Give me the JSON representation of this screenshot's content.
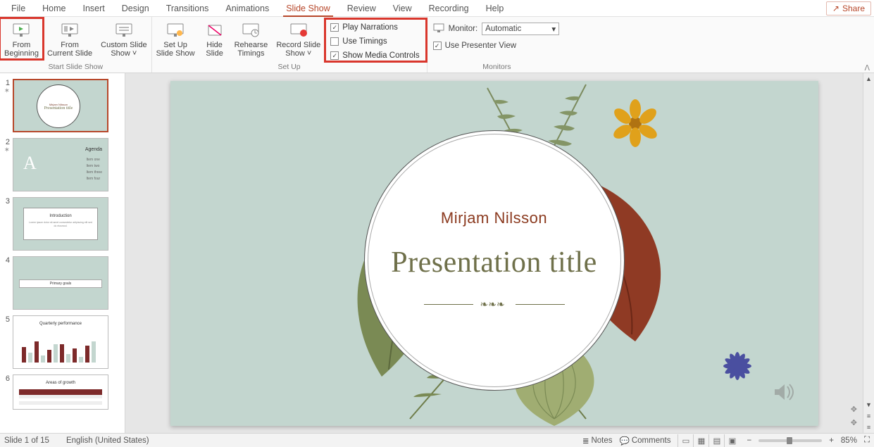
{
  "tabs": [
    "File",
    "Home",
    "Insert",
    "Design",
    "Transitions",
    "Animations",
    "Slide Show",
    "Review",
    "View",
    "Recording",
    "Help"
  ],
  "active_tab": "Slide Show",
  "share_label": "Share",
  "ribbon": {
    "start_group_label": "Start Slide Show",
    "setup_group_label": "Set Up",
    "monitors_group_label": "Monitors",
    "from_beginning": "From\nBeginning",
    "from_current": "From\nCurrent Slide",
    "custom_show": "Custom Slide\nShow ˅",
    "set_up": "Set Up\nSlide Show",
    "hide_slide": "Hide\nSlide",
    "rehearse": "Rehearse\nTimings",
    "record": "Record Slide\nShow ˅",
    "play_narrations": "Play Narrations",
    "use_timings": "Use Timings",
    "show_media": "Show Media Controls",
    "monitor_label": "Monitor:",
    "monitor_value": "Automatic",
    "presenter_view": "Use Presenter View"
  },
  "slide": {
    "author": "Mirjam Nilsson",
    "title": "Presentation title"
  },
  "thumbnails": [
    {
      "n": "1",
      "star": true,
      "variant": "title"
    },
    {
      "n": "2",
      "star": true,
      "variant": "agenda",
      "title": "Agenda"
    },
    {
      "n": "3",
      "star": false,
      "variant": "intro",
      "title": "Introduction"
    },
    {
      "n": "4",
      "star": false,
      "variant": "goals",
      "title": "Primary goals"
    },
    {
      "n": "5",
      "star": false,
      "variant": "chart",
      "title": "Quarterly performance"
    },
    {
      "n": "6",
      "star": false,
      "variant": "table",
      "title": "Areas of growth"
    }
  ],
  "status": {
    "slide_of": "Slide 1 of 15",
    "language": "English (United States)",
    "notes": "Notes",
    "comments": "Comments",
    "zoom": "85%"
  }
}
